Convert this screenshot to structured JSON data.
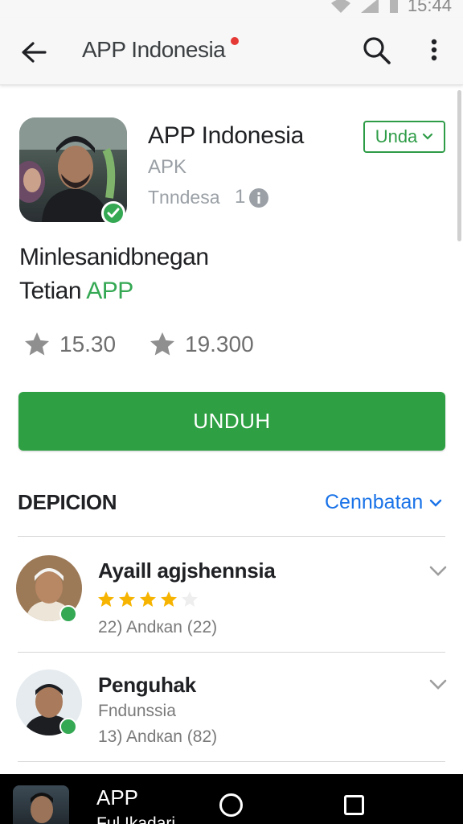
{
  "status_bar": {
    "time": "15:44"
  },
  "app_bar": {
    "title": "APP Indonesia",
    "back_icon": "arrow-back-icon",
    "search_icon": "search-icon",
    "more_icon": "more-vert-icon"
  },
  "app": {
    "name": "APP Indonesia",
    "type": "APK",
    "developer": "Tnndesa",
    "developer_count": "1",
    "language_button": "Unda"
  },
  "description": {
    "line1": "Minlesanidbnegan",
    "line2_prefix": "Tetian ",
    "line2_accent": "APP"
  },
  "stats": [
    {
      "icon": "star-icon",
      "value": "15.30"
    },
    {
      "icon": "star-icon",
      "value": "19.300"
    }
  ],
  "install_button": "UNDUH",
  "section": {
    "title": "DEPICION",
    "link": "Cennbatan"
  },
  "reviews": [
    {
      "name": "Ayaill agjshennsia",
      "rating": 4,
      "max": 5,
      "meta": "22)  Andкan  (22)"
    },
    {
      "name": "Penguhak",
      "subtitle": "Fndunssia",
      "meta": "13)  Andкan  (82)"
    }
  ],
  "bottom": {
    "title": "APP",
    "subtitle": "Ful  Ikadari"
  },
  "colors": {
    "accent_green": "#2ea043",
    "link_blue": "#1a73e8",
    "star_gold": "#f6b400"
  }
}
